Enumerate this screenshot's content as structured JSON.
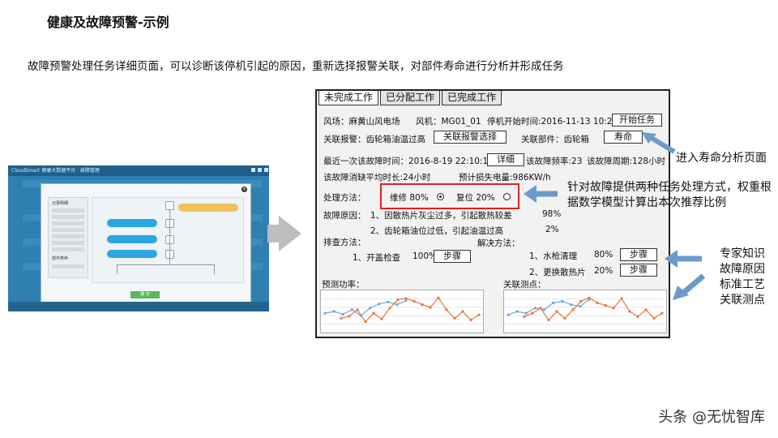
{
  "slide": {
    "title": "健康及故障预警-示例",
    "description": "故障预警处理任务详细页面，可以诊断该停机引起的原因，重新选择报警关联，对部件寿命进行分析并形成任务"
  },
  "thumbnail": {
    "app_title": "CloudSmart 健康大数据平台 · 故障管理",
    "left_panel_title": "记录明细",
    "left_panel_subtitle": "部件寿命",
    "ok_button": "确 定"
  },
  "tabs": [
    {
      "label": "未完成工作",
      "active": true
    },
    {
      "label": "已分配工作",
      "active": false
    },
    {
      "label": "已完成工作",
      "active": false
    }
  ],
  "form": {
    "wind_farm": "风场：麻黄山风电场",
    "turbine": "风机：MG01_01",
    "stop_time": "停机开始时间:2016-11-13  10:20:15",
    "start_task_button": "开始任务",
    "alarm": "关联报警：齿轮箱油温过高",
    "alarm_select_button": "关联报警选择",
    "component": "关联部件：齿轮箱",
    "life_button": "寿命",
    "last_time": "最近一次该故障时间：2016-8-19 22:10:10",
    "detail_button": "详细",
    "frequency": "该故障频率:23",
    "period": "该故障周期:128小时",
    "avg_duration": "该故障消缺平均时长:24小时",
    "expected_loss": "预计损失电量:986KW/h",
    "method_label": "处理方法：",
    "method_repair": "维修  80%",
    "method_reset": "复位  20%",
    "cause_label": "故障原因：",
    "cause_1": "1、因散热片灰尘过多，引起散热较差",
    "cause_1_pct": "98%",
    "cause_2": "2、齿轮箱油位过低，引起油温过高",
    "cause_2_pct": "2%",
    "check_label": "排查方法：",
    "check_1": "1、开盖检查",
    "check_1_pct": "100%",
    "steps_button": "步骤",
    "solution_label": "解决方法：",
    "solution_1": "1、水枪清理",
    "solution_1_pct": "80%",
    "solution_2": "2、更换散热片",
    "solution_2_pct": "20%",
    "power_label": "预测功率：",
    "points_label": "关联测点："
  },
  "annotations": {
    "life_analysis": "进入寿命分析页面",
    "method_note": "针对故障提供两种任务处理方式，权重根据数学模型计算出本次推荐比例",
    "expert_note": [
      "专家知识",
      "故障原因",
      "标准工艺",
      "关联测点"
    ]
  },
  "watermark": "头条 @无忧智库",
  "colors": {
    "series_blue": "#6fa8dc",
    "series_orange": "#e8743b",
    "annotation_arrow": "#6b9bc9",
    "highlight_red": "#e02020"
  },
  "chart_data": [
    {
      "type": "line",
      "series": [
        {
          "values": [
            0.45,
            0.5,
            0.42,
            0.55,
            0.38,
            0.6,
            0.72,
            0.78,
            0.7,
            0.82
          ]
        },
        {
          "values": [
            0.3,
            0.36,
            0.55,
            0.2,
            0.45,
            0.28,
            0.6,
            0.85,
            0.88,
            0.8,
            0.7,
            0.62,
            0.9,
            0.55,
            0.3,
            0.5,
            0.25,
            0.4
          ]
        }
      ]
    },
    {
      "type": "line",
      "series": [
        {
          "values": [
            0.4,
            0.5,
            0.45,
            0.6,
            0.55,
            0.75,
            0.8,
            0.7,
            0.65,
            0.85
          ]
        },
        {
          "values": [
            0.35,
            0.45,
            0.6,
            0.25,
            0.5,
            0.3,
            0.55,
            0.8,
            0.9,
            0.75,
            0.68,
            0.6,
            0.88,
            0.5,
            0.35,
            0.55,
            0.3,
            0.45
          ]
        }
      ]
    }
  ]
}
